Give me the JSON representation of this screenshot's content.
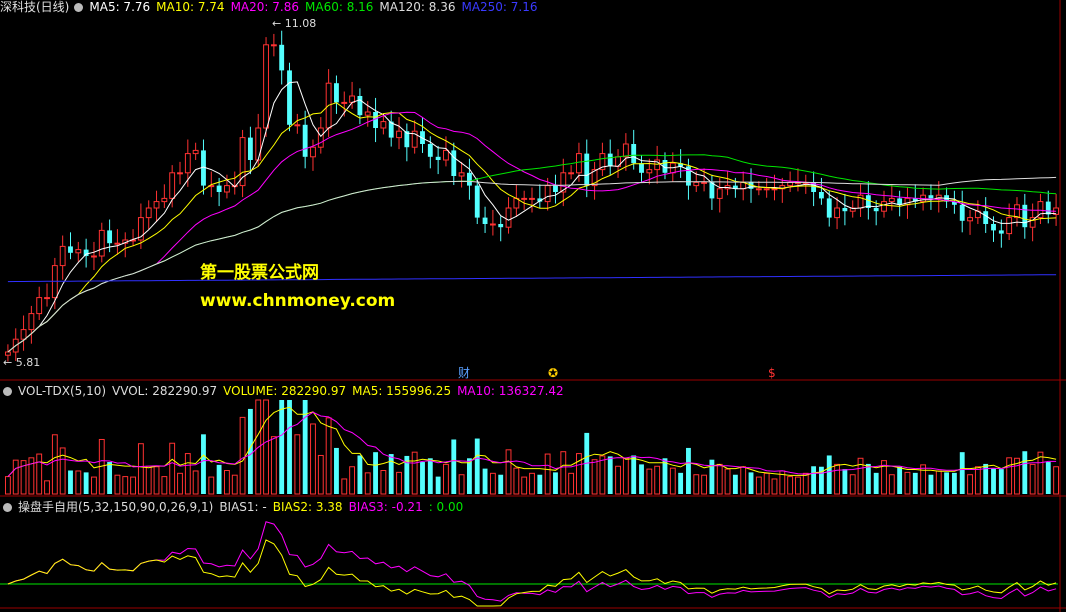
{
  "panel_main": {
    "title": "深科技(日线)",
    "ma5": "MA5: 7.76",
    "ma10": "MA10: 7.74",
    "ma20": "MA20: 7.86",
    "ma60": "MA60: 8.16",
    "ma120": "MA120: 8.36",
    "ma250": "MA250: 7.16",
    "high_label": "11.08",
    "low_label": "5.81",
    "watermark_cn": "第一股票公式网",
    "watermark_url": "www.chnmoney.com",
    "markers": [
      "财",
      "✪",
      "$"
    ]
  },
  "panel_vol": {
    "title": "VOL-TDX(5,10)",
    "vvol": "VVOL: 282290.97",
    "volume": "VOLUME: 282290.97",
    "ma5": "MA5: 155996.25",
    "ma10": "MA10: 136327.42"
  },
  "panel_bias": {
    "title": "操盘手自用(5,32,150,90,0,26,9,1)",
    "bias1": "BIAS1: -",
    "bias2": "BIAS2: 3.38",
    "bias3": "BIAS3: -0.21",
    "extra": ": 0.00"
  },
  "colors": {
    "up": "#ff3232",
    "down": "#54ffff",
    "ma5": "#ffffff",
    "ma10": "#ffff00",
    "ma20": "#ff00ff",
    "ma60": "#00e600",
    "ma120": "#dddddd",
    "ma250": "#3030ff",
    "grid": "#9a0000"
  },
  "chart_data": [
    {
      "type": "candlestick",
      "x": [
        1,
        2,
        3,
        4,
        5,
        6,
        7,
        8,
        9,
        10,
        11,
        12,
        13,
        14,
        15,
        16,
        17,
        18,
        19,
        20,
        21,
        22,
        23,
        24,
        25,
        26,
        27,
        28,
        29,
        30,
        31,
        32,
        33,
        34,
        35,
        36,
        37,
        38,
        39,
        40,
        41,
        42,
        43,
        44,
        45,
        46,
        47,
        48,
        49,
        50,
        51,
        52,
        53,
        54,
        55,
        56,
        57,
        58,
        59,
        60,
        61,
        62,
        63,
        64,
        65,
        66,
        67,
        68,
        69,
        70,
        71,
        72,
        73,
        74,
        75,
        76,
        77,
        78,
        79,
        80,
        81,
        82,
        83,
        84,
        85,
        86,
        87,
        88,
        89,
        90,
        91,
        92,
        93,
        94,
        95,
        96,
        97,
        98,
        99,
        100,
        101,
        102,
        103,
        104,
        105,
        106,
        107,
        108,
        109,
        110,
        111,
        112,
        113,
        114,
        115,
        116,
        117,
        118,
        119,
        120,
        121,
        122,
        123,
        124,
        125,
        126,
        127,
        128,
        129,
        130,
        131,
        132,
        133,
        134,
        135,
        136,
        137,
        138,
        139,
        140,
        141,
        142,
        143,
        144,
        145,
        146,
        147,
        148,
        149,
        150,
        151,
        152,
        153,
        154,
        155,
        156,
        157
      ],
      "open": [
        5.9,
        5.95,
        6.15,
        6.3,
        6.55,
        6.8,
        6.8,
        7.3,
        7.6,
        7.5,
        7.55,
        7.45,
        7.45,
        7.85,
        7.65,
        7.65,
        7.7,
        7.7,
        8.05,
        8.2,
        8.3,
        8.35,
        8.75,
        8.75,
        9.05,
        9.1,
        8.55,
        8.55,
        8.45,
        8.55,
        8.55,
        9.3,
        8.95,
        9.45,
        10.75,
        10.75,
        10.35,
        9.5,
        9.5,
        9.0,
        9.15,
        9.45,
        10.15,
        9.85,
        9.85,
        9.95,
        9.65,
        9.7,
        9.45,
        9.55,
        9.3,
        9.4,
        9.15,
        9.4,
        9.2,
        9.0,
        8.95,
        9.1,
        8.7,
        8.75,
        8.55,
        8.05,
        7.95,
        7.95,
        7.9,
        8.2,
        8.35,
        8.35,
        8.35,
        8.3,
        8.55,
        8.45,
        8.75,
        8.75,
        9.05,
        8.55,
        8.8,
        9.05,
        8.85,
        9.0,
        9.2,
        8.9,
        8.75,
        8.8,
        8.95,
        8.75,
        8.9,
        8.85,
        8.55,
        8.6,
        8.6,
        8.35,
        8.5,
        8.55,
        8.5,
        8.6,
        8.5,
        8.5,
        8.5,
        8.5,
        8.55,
        8.6,
        8.6,
        8.6,
        8.45,
        8.35,
        8.05,
        8.2,
        8.15,
        8.2,
        8.4,
        8.2,
        8.15,
        8.3,
        8.35,
        8.25,
        8.35,
        8.3,
        8.4,
        8.35,
        8.4,
        8.3,
        8.25,
        8.0,
        8.05,
        8.15,
        7.95,
        7.85,
        7.8,
        8.05,
        8.25,
        7.9,
        8.05,
        8.3,
        8.1
      ],
      "close": [
        5.95,
        6.15,
        6.3,
        6.55,
        6.8,
        6.8,
        7.3,
        7.6,
        7.5,
        7.55,
        7.45,
        7.45,
        7.85,
        7.65,
        7.65,
        7.7,
        7.7,
        8.05,
        8.2,
        8.3,
        8.35,
        8.75,
        8.75,
        9.05,
        9.1,
        8.55,
        8.55,
        8.45,
        8.55,
        8.55,
        9.3,
        8.95,
        9.45,
        10.75,
        10.75,
        10.35,
        9.5,
        9.5,
        9.0,
        9.15,
        9.45,
        10.15,
        9.85,
        9.85,
        9.95,
        9.65,
        9.7,
        9.45,
        9.55,
        9.3,
        9.4,
        9.15,
        9.4,
        9.2,
        9.0,
        8.95,
        9.1,
        8.7,
        8.75,
        8.55,
        8.05,
        7.95,
        7.95,
        7.9,
        8.2,
        8.35,
        8.35,
        8.35,
        8.3,
        8.55,
        8.45,
        8.75,
        8.75,
        9.05,
        8.55,
        8.8,
        9.05,
        8.85,
        9.0,
        9.2,
        8.9,
        8.75,
        8.8,
        8.95,
        8.75,
        8.9,
        8.85,
        8.55,
        8.6,
        8.6,
        8.35,
        8.5,
        8.55,
        8.5,
        8.6,
        8.5,
        8.5,
        8.5,
        8.5,
        8.55,
        8.6,
        8.6,
        8.6,
        8.45,
        8.35,
        8.05,
        8.2,
        8.15,
        8.2,
        8.4,
        8.2,
        8.15,
        8.3,
        8.35,
        8.25,
        8.35,
        8.3,
        8.4,
        8.35,
        8.4,
        8.3,
        8.25,
        8.0,
        8.05,
        8.15,
        7.95,
        7.85,
        7.8,
        8.05,
        8.25,
        7.9,
        8.05,
        8.3,
        8.1,
        8.2
      ],
      "ylim": [
        5.7,
        11.2
      ]
    }
  ]
}
